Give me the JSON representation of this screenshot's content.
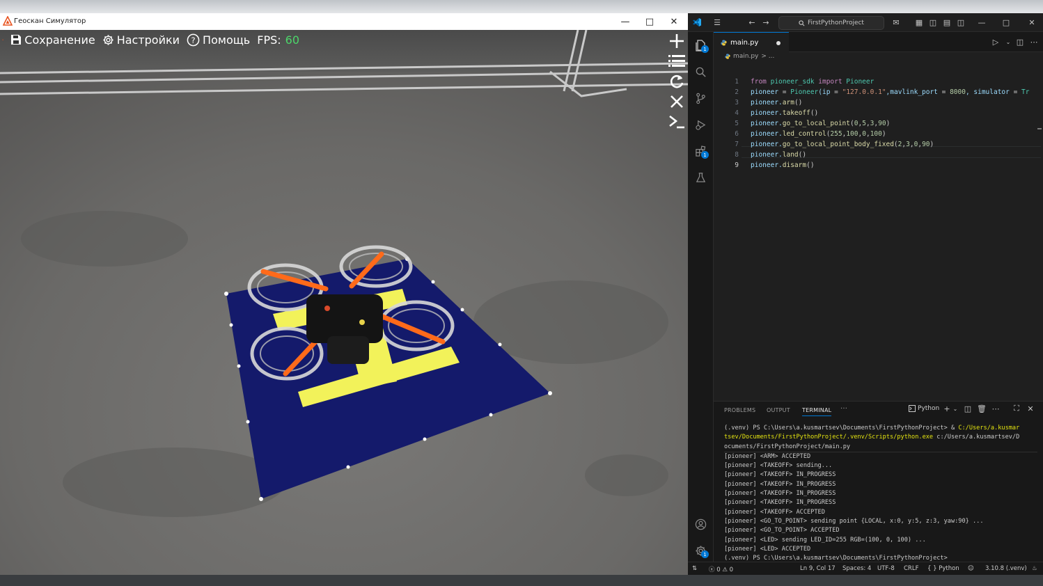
{
  "simulator": {
    "window_title": "Геоскан Симулятор",
    "toolbar": {
      "save_label": "Сохранение",
      "settings_label": "Настройки",
      "help_label": "Помощь",
      "fps_label": "FPS:",
      "fps_value": "60"
    },
    "side_tools": [
      "plus-icon",
      "list-icon",
      "reset-icon",
      "close-icon",
      "terminal-icon"
    ],
    "colors": {
      "accent": "#e8531f",
      "fps": "#4cd66a",
      "pad": "#141a6b",
      "pad_marking": "#f2f25a"
    }
  },
  "vscode": {
    "search_text": "FirstPythonProject",
    "tab": {
      "filename": "main.py"
    },
    "breadcrumb": {
      "file": "main.py",
      "sep": "> ..."
    },
    "code_lines": [
      {
        "num": "1",
        "tokens": [
          {
            "t": "from ",
            "c": "k"
          },
          {
            "t": "pioneer_sdk ",
            "c": "c"
          },
          {
            "t": "import ",
            "c": "k"
          },
          {
            "t": "Pioneer",
            "c": "c"
          }
        ]
      },
      {
        "num": "2",
        "tokens": [
          {
            "t": "pioneer ",
            "c": "v"
          },
          {
            "t": "= ",
            "c": "p"
          },
          {
            "t": "Pioneer",
            "c": "c"
          },
          {
            "t": "(ip ",
            "c": "v"
          },
          {
            "t": "= ",
            "c": "p"
          },
          {
            "t": "\"127.0.0.1\"",
            "c": "s"
          },
          {
            "t": ",mavlink_port ",
            "c": "v"
          },
          {
            "t": "= ",
            "c": "p"
          },
          {
            "t": "8000",
            "c": "n"
          },
          {
            "t": ", simulator ",
            "c": "v"
          },
          {
            "t": "= ",
            "c": "p"
          },
          {
            "t": "Tr",
            "c": "c"
          }
        ]
      },
      {
        "num": "3",
        "tokens": [
          {
            "t": "pioneer.",
            "c": "v"
          },
          {
            "t": "arm",
            "c": "f"
          },
          {
            "t": "()",
            "c": "p"
          }
        ]
      },
      {
        "num": "4",
        "tokens": [
          {
            "t": "pioneer.",
            "c": "v"
          },
          {
            "t": "takeoff",
            "c": "f"
          },
          {
            "t": "()",
            "c": "p"
          }
        ]
      },
      {
        "num": "5",
        "tokens": [
          {
            "t": "pioneer.",
            "c": "v"
          },
          {
            "t": "go_to_local_point",
            "c": "f"
          },
          {
            "t": "(",
            "c": "p"
          },
          {
            "t": "0",
            "c": "n"
          },
          {
            "t": ",",
            "c": "p"
          },
          {
            "t": "5",
            "c": "n"
          },
          {
            "t": ",",
            "c": "p"
          },
          {
            "t": "3",
            "c": "n"
          },
          {
            "t": ",",
            "c": "p"
          },
          {
            "t": "90",
            "c": "n"
          },
          {
            "t": ")",
            "c": "p"
          }
        ]
      },
      {
        "num": "6",
        "tokens": [
          {
            "t": "pioneer.",
            "c": "v"
          },
          {
            "t": "led_control",
            "c": "f"
          },
          {
            "t": "(",
            "c": "p"
          },
          {
            "t": "255",
            "c": "n"
          },
          {
            "t": ",",
            "c": "p"
          },
          {
            "t": "100",
            "c": "n"
          },
          {
            "t": ",",
            "c": "p"
          },
          {
            "t": "0",
            "c": "n"
          },
          {
            "t": ",",
            "c": "p"
          },
          {
            "t": "100",
            "c": "n"
          },
          {
            "t": ")",
            "c": "p"
          }
        ]
      },
      {
        "num": "7",
        "tokens": [
          {
            "t": "pioneer.",
            "c": "v"
          },
          {
            "t": "go_to_local_point_body_fixed",
            "c": "f"
          },
          {
            "t": "(",
            "c": "p"
          },
          {
            "t": "2",
            "c": "n"
          },
          {
            "t": ",",
            "c": "p"
          },
          {
            "t": "3",
            "c": "n"
          },
          {
            "t": ",",
            "c": "p"
          },
          {
            "t": "0",
            "c": "n"
          },
          {
            "t": ",",
            "c": "p"
          },
          {
            "t": "90",
            "c": "n"
          },
          {
            "t": ")",
            "c": "p"
          }
        ]
      },
      {
        "num": "8",
        "tokens": [
          {
            "t": "pioneer.",
            "c": "v"
          },
          {
            "t": "land",
            "c": "f"
          },
          {
            "t": "()",
            "c": "p"
          }
        ]
      },
      {
        "num": "9",
        "tokens": [
          {
            "t": "pioneer.",
            "c": "v"
          },
          {
            "t": "disarm",
            "c": "f"
          },
          {
            "t": "()",
            "c": "p"
          }
        ]
      }
    ],
    "panel": {
      "tabs": [
        "PROBLEMS",
        "OUTPUT",
        "TERMINAL"
      ],
      "more": "···",
      "terminal_profile": "Python",
      "terminal_lines": [
        {
          "parts": [
            {
              "t": "(.venv) PS C:\\Users\\a.kusmartsev\\Documents\\FirstPythonProject> & ",
              "y": false
            },
            {
              "t": "C:/Users/a.kusmar",
              "y": true
            }
          ]
        },
        {
          "parts": [
            {
              "t": "tsev/Documents/FirstPythonProject/.venv/Scripts/python.exe",
              "y": true
            },
            {
              "t": " c:/Users/a.kusmartsev/D",
              "y": false
            }
          ]
        },
        {
          "parts": [
            {
              "t": "ocuments/FirstPythonProject/main.py",
              "y": false
            }
          ]
        },
        {
          "parts": [
            {
              "t": "[pioneer] <ARM> ACCEPTED",
              "y": false
            }
          ]
        },
        {
          "parts": [
            {
              "t": "[pioneer] <TAKEOFF> sending...",
              "y": false
            }
          ]
        },
        {
          "parts": [
            {
              "t": "[pioneer] <TAKEOFF> IN_PROGRESS",
              "y": false
            }
          ]
        },
        {
          "parts": [
            {
              "t": "[pioneer] <TAKEOFF> IN_PROGRESS",
              "y": false
            }
          ]
        },
        {
          "parts": [
            {
              "t": "[pioneer] <TAKEOFF> IN_PROGRESS",
              "y": false
            }
          ]
        },
        {
          "parts": [
            {
              "t": "[pioneer] <TAKEOFF> IN_PROGRESS",
              "y": false
            }
          ]
        },
        {
          "parts": [
            {
              "t": "[pioneer] <TAKEOFF> ACCEPTED",
              "y": false
            }
          ]
        },
        {
          "parts": [
            {
              "t": "[pioneer] <GO_TO_POINT> sending point {LOCAL, x:0, y:5, z:3, yaw:90} ...",
              "y": false
            }
          ]
        },
        {
          "parts": [
            {
              "t": "[pioneer] <GO_TO_POINT> ACCEPTED",
              "y": false
            }
          ]
        },
        {
          "parts": [
            {
              "t": "[pioneer] <LED> sending LED_ID=255 RGB=(100, 0, 100) ...",
              "y": false
            }
          ]
        },
        {
          "parts": [
            {
              "t": "[pioneer] <LED> ACCEPTED",
              "y": false
            }
          ]
        },
        {
          "parts": [
            {
              "t": "(.venv) PS C:\\Users\\a.kusmartsev\\Documents\\FirstPythonProject>",
              "y": false
            }
          ]
        }
      ]
    },
    "statusbar": {
      "errors": "0",
      "warnings": "0",
      "position": "Ln 9, Col 17",
      "spaces": "Spaces: 4",
      "encoding": "UTF-8",
      "eol": "CRLF",
      "language": "Python",
      "interpreter": "3.10.8 (.venv)"
    },
    "activity_badges": {
      "explorer": "1",
      "extensions": "1",
      "settings": "1"
    },
    "colors": {
      "accent": "#0078d4"
    }
  }
}
